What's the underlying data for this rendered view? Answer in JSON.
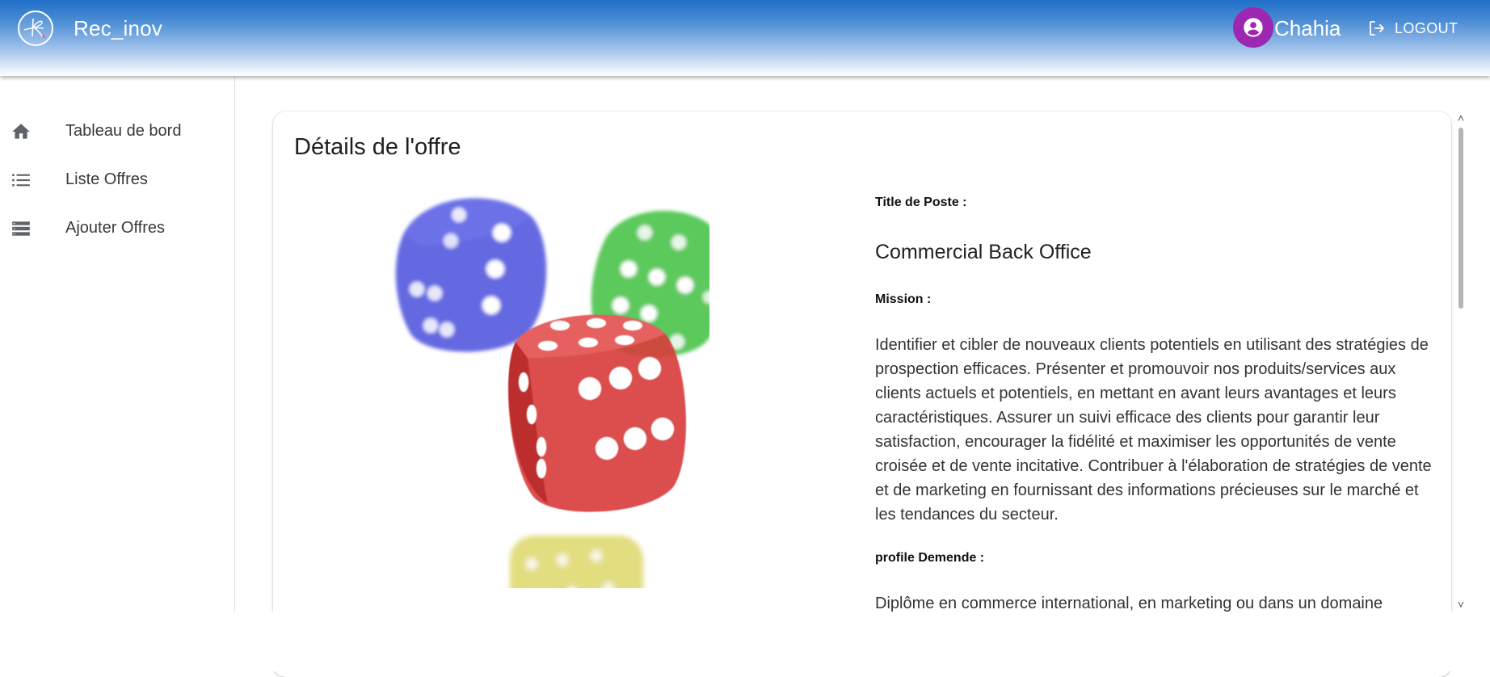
{
  "header": {
    "app_name": "Rec_inov",
    "user_name": "Chahia",
    "logout_label": "LOGOUT"
  },
  "sidebar": {
    "items": [
      {
        "label": "Tableau de bord",
        "icon": "home-icon"
      },
      {
        "label": "Liste Offres",
        "icon": "list-icon"
      },
      {
        "label": "Ajouter Offres",
        "icon": "storage-icon"
      }
    ]
  },
  "offer": {
    "heading": "Détails de l'offre",
    "title_label": "Title de Poste :",
    "title_value": "Commercial Back Office",
    "mission_label": "Mission :",
    "mission_text": "Identifier et cibler de nouveaux clients potentiels en utilisant des stratégies de prospection efficaces. Présenter et promouvoir nos produits/services aux clients actuels et potentiels, en mettant en avant leurs avantages et leurs caractéristiques. Assurer un suivi efficace des clients pour garantir leur satisfaction, encourager la fidélité et maximiser les opportunités de vente croisée et de vente incitative. Contribuer à l'élaboration de stratégies de vente et de marketing en fournissant des informations précieuses sur le marché et les tendances du secteur.",
    "profile_label": "profile Demende :",
    "profile_text": "Diplôme en commerce international, en marketing ou dans un domaine"
  },
  "colors": {
    "header_gradient_top": "#1f6ec8",
    "avatar_bg": "#9c27b0",
    "sidebar_icon": "#5f6368"
  }
}
